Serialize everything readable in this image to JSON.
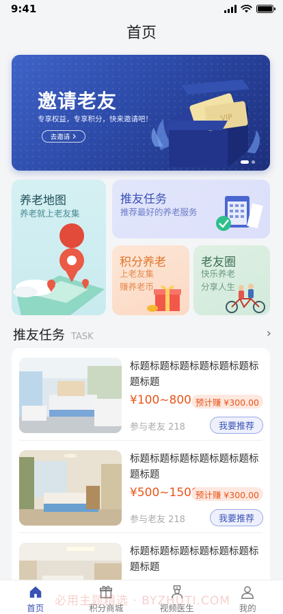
{
  "status_bar": {
    "time": "9:41"
  },
  "nav": {
    "title": "首页"
  },
  "banner": {
    "title": "邀请老友",
    "subtitle": "专享权益，专享积分，快来邀请吧！",
    "button": "去邀请",
    "card_text": "VIP",
    "active_slide": 1,
    "slide_count": 2
  },
  "features": {
    "map": {
      "title": "养老地图",
      "subtitle": "养老就上老友集"
    },
    "task": {
      "title": "推友任务",
      "subtitle": "推荐最好的养老服务"
    },
    "points": {
      "title": "积分养老",
      "line1": "上老友集",
      "line2": "赚养老币"
    },
    "circle": {
      "title": "老友圈",
      "line1": "快乐养老",
      "line2": "分享人生"
    }
  },
  "section": {
    "title": "推友任务",
    "subtitle": "TASK",
    "arrow": "›"
  },
  "tasks": [
    {
      "title": "标题标题标题标题标题标题标题标题",
      "price": "¥100~800",
      "estimate": "预计赚 ¥300.00",
      "participants": "参与老友  218",
      "button": "我要推荐"
    },
    {
      "title": "标题标题标题标题标题标题标题标题",
      "price": "¥500~1500",
      "estimate": "预计赚 ¥300.00",
      "participants": "参与老友  218",
      "button": "我要推荐"
    },
    {
      "title": "标题标题标题标题标题标题标题标题",
      "price": "",
      "estimate": "",
      "participants": "",
      "button": ""
    }
  ],
  "tabbar": [
    {
      "label": "首页",
      "icon": "home-icon",
      "active": true
    },
    {
      "label": "积分商城",
      "icon": "gift-icon",
      "active": false
    },
    {
      "label": "视频医生",
      "icon": "doctor-icon",
      "active": false
    },
    {
      "label": "我的",
      "icon": "user-icon",
      "active": false
    }
  ],
  "watermark": "必用主题精选 · BYZHUTI.COM",
  "colors": {
    "primary": "#3a52b6",
    "accent_orange": "#e8551b",
    "bg": "#f4f5f7"
  }
}
